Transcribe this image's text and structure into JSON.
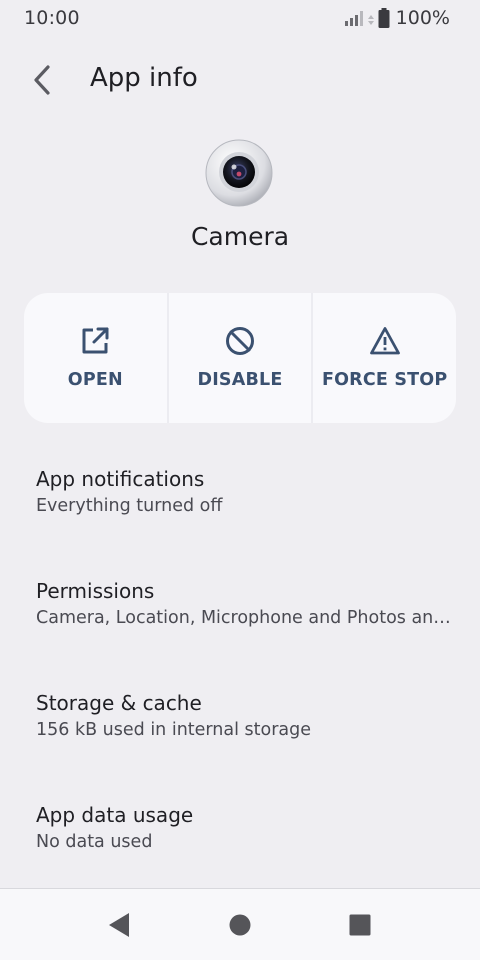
{
  "status_bar": {
    "time": "10:00",
    "battery_percent": "100%",
    "icons": [
      "signal-icon",
      "data-arrows-icon",
      "battery-icon"
    ]
  },
  "app_bar": {
    "title": "App info",
    "back_icon": "back-arrow-icon"
  },
  "app": {
    "name": "Camera",
    "icon": "camera-app-icon"
  },
  "actions": [
    {
      "label": "OPEN",
      "icon": "open-external-icon"
    },
    {
      "label": "DISABLE",
      "icon": "disable-icon"
    },
    {
      "label": "FORCE STOP",
      "icon": "warning-triangle-icon"
    }
  ],
  "settings": [
    {
      "title": "App notifications",
      "summary": "Everything turned off"
    },
    {
      "title": "Permissions",
      "summary": "Camera, Location, Microphone and Photos and videos"
    },
    {
      "title": "Storage & cache",
      "summary": "156 kB used in internal storage"
    },
    {
      "title": "App data usage",
      "summary": "No data used"
    }
  ],
  "nav_bar": {
    "buttons": [
      "nav-back-icon",
      "nav-home-icon",
      "nav-recents-icon"
    ]
  },
  "colors": {
    "background": "#efeef2",
    "card": "#f9f9fc",
    "accent": "#3b5170",
    "text_primary": "#1f1f24",
    "text_secondary": "#4a4a52"
  }
}
